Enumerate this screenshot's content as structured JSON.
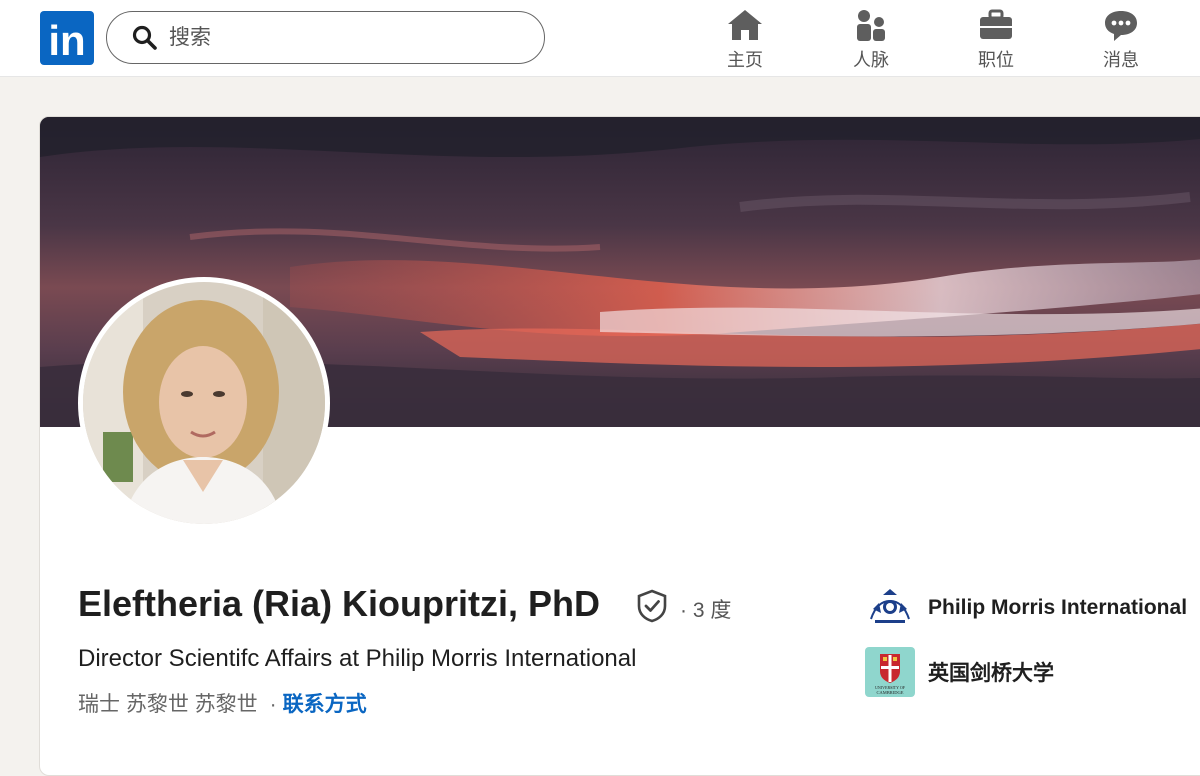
{
  "header": {
    "logo_text": "in",
    "search": {
      "placeholder": "搜索",
      "value": ""
    },
    "nav": [
      {
        "label": "主页",
        "icon": "home-icon"
      },
      {
        "label": "人脉",
        "icon": "people-icon"
      },
      {
        "label": "职位",
        "icon": "briefcase-icon"
      },
      {
        "label": "消息",
        "icon": "chat-icon"
      }
    ]
  },
  "profile": {
    "name": "Eleftheria (Ria) Kioupritzi, PhD",
    "degree": "· 3 度",
    "headline": "Director Scientifc Affairs at Philip Morris International",
    "location": "瑞士 苏黎世 苏黎世",
    "separator": "·",
    "contact_label": "联系方式",
    "companies": [
      {
        "name": "Philip Morris International",
        "logo": "pmi-logo"
      },
      {
        "name": "英国剑桥大学",
        "logo": "cambridge-logo",
        "logo_text": [
          "UNIVERSITY OF",
          "CAMBRIDGE"
        ]
      }
    ]
  },
  "colors": {
    "brand": "#0a66c2",
    "background": "#f4f2ee",
    "text": "#1f1f1f",
    "muted": "#666666"
  }
}
